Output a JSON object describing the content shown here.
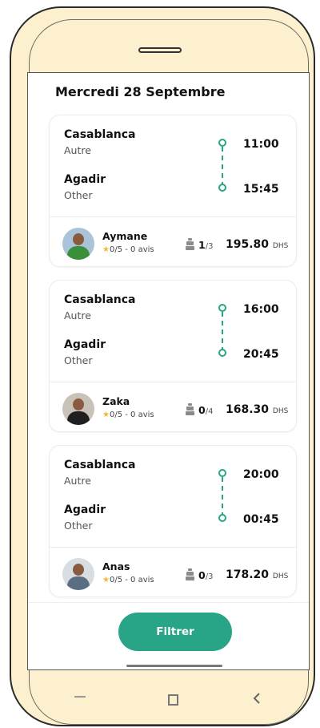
{
  "header": {
    "date_title": "Mercredi 28 Septembre"
  },
  "trips": [
    {
      "from": {
        "city": "Casablanca",
        "sub": "Autre",
        "time": "11:00"
      },
      "to": {
        "city": "Agadir",
        "sub": "Other",
        "time": "15:45"
      },
      "driver": {
        "name": "Aymane",
        "rating": "0/5 - 0 avis",
        "shirt_color": "#3c8f3a"
      },
      "seats": {
        "taken": "1",
        "total": "/3"
      },
      "price": {
        "amount": "195.80",
        "currency": "DHS"
      }
    },
    {
      "from": {
        "city": "Casablanca",
        "sub": "Autre",
        "time": "16:00"
      },
      "to": {
        "city": "Agadir",
        "sub": "Other",
        "time": "20:45"
      },
      "driver": {
        "name": "Zaka",
        "rating": "0/5 - 0 avis",
        "shirt_color": "#1f1f1f"
      },
      "seats": {
        "taken": "0",
        "total": "/4"
      },
      "price": {
        "amount": "168.30",
        "currency": "DHS"
      }
    },
    {
      "from": {
        "city": "Casablanca",
        "sub": "Autre",
        "time": "20:00"
      },
      "to": {
        "city": "Agadir",
        "sub": "Other",
        "time": "00:45"
      },
      "driver": {
        "name": "Anas",
        "rating": "0/5 - 0 avis",
        "shirt_color": "#5a6e82"
      },
      "seats": {
        "taken": "0",
        "total": "/3"
      },
      "price": {
        "amount": "178.20",
        "currency": "DHS"
      }
    }
  ],
  "actions": {
    "filter_label": "Filtrer"
  },
  "colors": {
    "accent": "#27a586",
    "star": "#f1b928",
    "frame": "#fdf0cf"
  },
  "icons": [
    "route-dot-icon",
    "star-icon",
    "seat-icon",
    "nav-recents-icon",
    "nav-home-icon",
    "nav-back-icon"
  ]
}
